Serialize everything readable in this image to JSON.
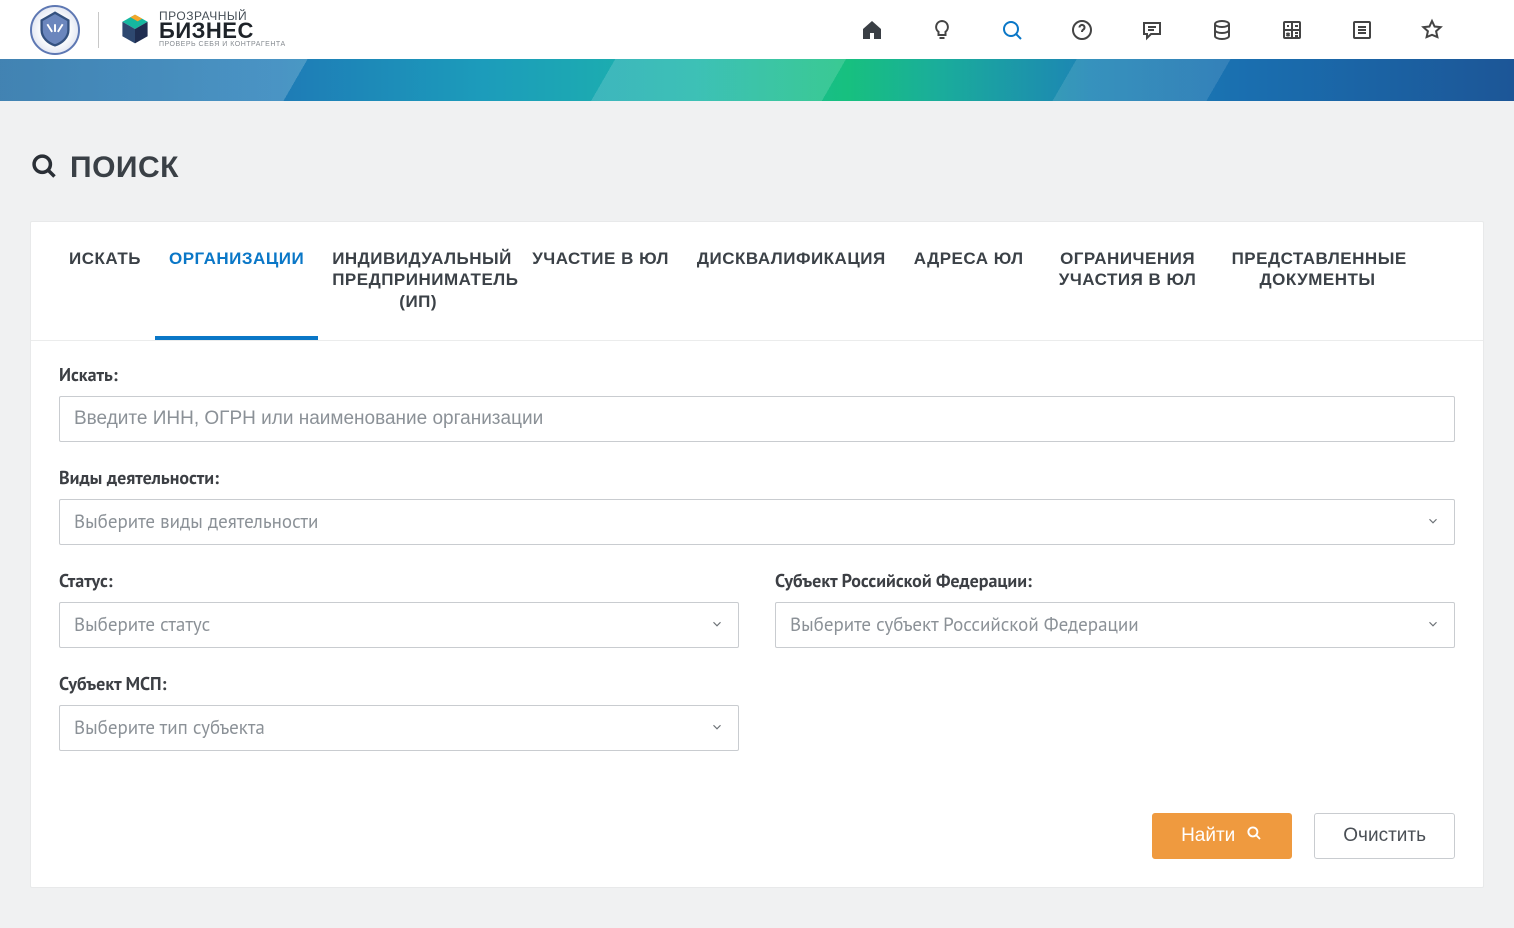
{
  "header": {
    "logo_line1": "ПРОЗРАЧНЫЙ",
    "logo_line2": "БИЗНЕС",
    "logo_line3": "ПРОВЕРЬ СЕБЯ И КОНТРАГЕНТА"
  },
  "page_title": "ПОИСК",
  "tabs": [
    {
      "label": "ИСКАТЬ"
    },
    {
      "label": "ОРГАНИЗАЦИИ"
    },
    {
      "label": "ИНДИВИДУАЛЬНЫЙ ПРЕДПРИНИМАТЕЛЬ\n(ИП)"
    },
    {
      "label": "УЧАСТИЕ В ЮЛ"
    },
    {
      "label": "ДИСКВАЛИФИКАЦИЯ"
    },
    {
      "label": "АДРЕСА ЮЛ"
    },
    {
      "label": "ОГРАНИЧЕНИЯ УЧАСТИЯ В ЮЛ"
    },
    {
      "label": "ПРЕДСТАВЛЕННЫЕ ДОКУМЕНТЫ"
    }
  ],
  "active_tab_index": 1,
  "form": {
    "search_label": "Искать:",
    "search_placeholder": "Введите ИНН, ОГРН или наименование организации",
    "activity_label": "Виды деятельности:",
    "activity_placeholder": "Выберите виды деятельности",
    "status_label": "Статус:",
    "status_placeholder": "Выберите статус",
    "region_label": "Субъект Российской Федерации:",
    "region_placeholder": "Выберите субъект Российской Федерации",
    "msp_label": "Субъект МСП:",
    "msp_placeholder": "Выберите тип субъекта"
  },
  "actions": {
    "find": "Найти",
    "clear": "Очистить"
  }
}
